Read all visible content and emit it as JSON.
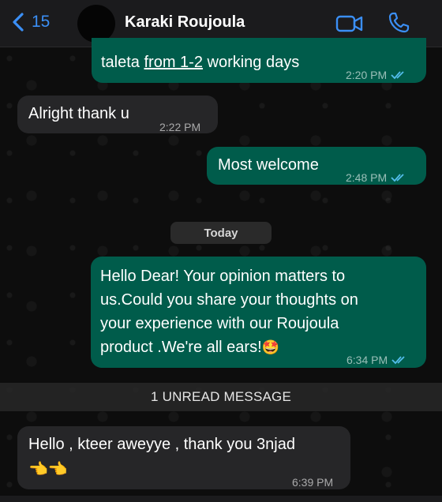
{
  "header": {
    "back_count": "15",
    "contact_name": "Karaki Roujoula"
  },
  "messages": [
    {
      "direction": "out",
      "text_plain": "taleta ",
      "text_link": "from 1-2",
      "text_rest": " working days",
      "time": "2:20 PM",
      "read": true
    },
    {
      "direction": "in",
      "text": "Alright thank u",
      "time": "2:22 PM"
    },
    {
      "direction": "out",
      "text": "Most welcome",
      "time": "2:48 PM",
      "read": true
    },
    {
      "direction": "out",
      "lines": [
        "Hello Dear! Your opinion matters to",
        "us.Could you share your thoughts on",
        "your experience with our Roujoula",
        "product .We're all ears!"
      ],
      "emoji": "🤩",
      "time": "6:34 PM",
      "read": true
    },
    {
      "direction": "in",
      "text": "Hello , kteer aweyye , thank you 3njad",
      "emoji": "👈👈",
      "time": "6:39 PM"
    }
  ],
  "day_separator": "Today",
  "unread_banner": "1 UNREAD MESSAGE",
  "colors": {
    "outgoing_bubble": "#005c4b",
    "incoming_bubble": "#262628",
    "accent": "#3b8ff5",
    "read_ticks": "#53bdeb"
  }
}
